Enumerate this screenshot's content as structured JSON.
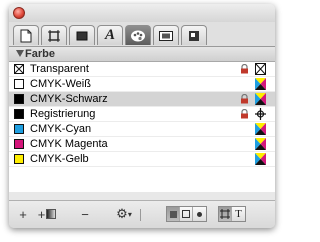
{
  "section": {
    "title": "Farbe"
  },
  "swatches": [
    {
      "name": "Transparent",
      "color": "none",
      "locked": true,
      "type_icon": "none-icon"
    },
    {
      "name": "CMYK-Weiß",
      "color": "#ffffff",
      "locked": false,
      "type_icon": "cmyk-process-icon"
    },
    {
      "name": "CMYK-Schwarz",
      "color": "#000000",
      "locked": true,
      "type_icon": "cmyk-process-icon",
      "selected": true
    },
    {
      "name": "Registrierung",
      "color": "#000000",
      "locked": true,
      "type_icon": "registration-icon"
    },
    {
      "name": "CMYK-Cyan",
      "color": "#1f9fe0",
      "locked": false,
      "type_icon": "cmyk-process-icon"
    },
    {
      "name": "CMYK Magenta",
      "color": "#d4157a",
      "locked": false,
      "type_icon": "cmyk-process-icon"
    },
    {
      "name": "CMYK-Gelb",
      "color": "#ffee00",
      "locked": false,
      "type_icon": "cmyk-process-icon"
    }
  ],
  "tabs": [
    {
      "icon": "document-icon"
    },
    {
      "icon": "frame-icon"
    },
    {
      "icon": "box-icon"
    },
    {
      "icon": "character-icon",
      "glyph": "A"
    },
    {
      "icon": "color-palette-icon",
      "active": true
    },
    {
      "icon": "picture-icon"
    },
    {
      "icon": "output-icon"
    }
  ],
  "toolbar": {
    "add": "+",
    "add_color": "+",
    "remove": "−",
    "gear": "⚙",
    "gear_arrow": "▾",
    "text_mode": "T"
  },
  "colors": {
    "selection": "#d4d4d4",
    "lock": "#c0392b"
  }
}
